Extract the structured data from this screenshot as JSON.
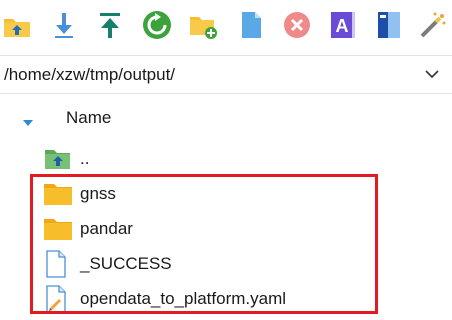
{
  "toolbar": {
    "buttons": [
      {
        "name": "parent-folder-button",
        "icon": "folder-up-icon"
      },
      {
        "name": "download-button",
        "icon": "download-arrow-icon"
      },
      {
        "name": "upload-button",
        "icon": "upload-arrow-icon"
      },
      {
        "name": "refresh-button",
        "icon": "refresh-icon"
      },
      {
        "name": "new-folder-button",
        "icon": "new-folder-icon"
      },
      {
        "name": "new-file-button",
        "icon": "new-file-icon"
      },
      {
        "name": "delete-button",
        "icon": "delete-icon"
      },
      {
        "name": "rename-button",
        "icon": "rename-icon"
      },
      {
        "name": "properties-button",
        "icon": "properties-icon"
      },
      {
        "name": "find-files-button",
        "icon": "magic-wand-icon"
      }
    ]
  },
  "path": {
    "value": "/home/xzw/tmp/output/"
  },
  "list": {
    "column_name": "Name",
    "sort": "ascending",
    "items": [
      {
        "label": "..",
        "type": "parent-directory"
      },
      {
        "label": "gnss",
        "type": "folder"
      },
      {
        "label": "pandar",
        "type": "folder"
      },
      {
        "label": "_SUCCESS",
        "type": "file"
      },
      {
        "label": "opendata_to_platform.yaml",
        "type": "yaml-file"
      }
    ]
  },
  "colors": {
    "highlight": "#e21b23",
    "folder": "#f7bd2a",
    "accent_green": "#3ca33c",
    "accent_blue": "#2a8ad4"
  }
}
